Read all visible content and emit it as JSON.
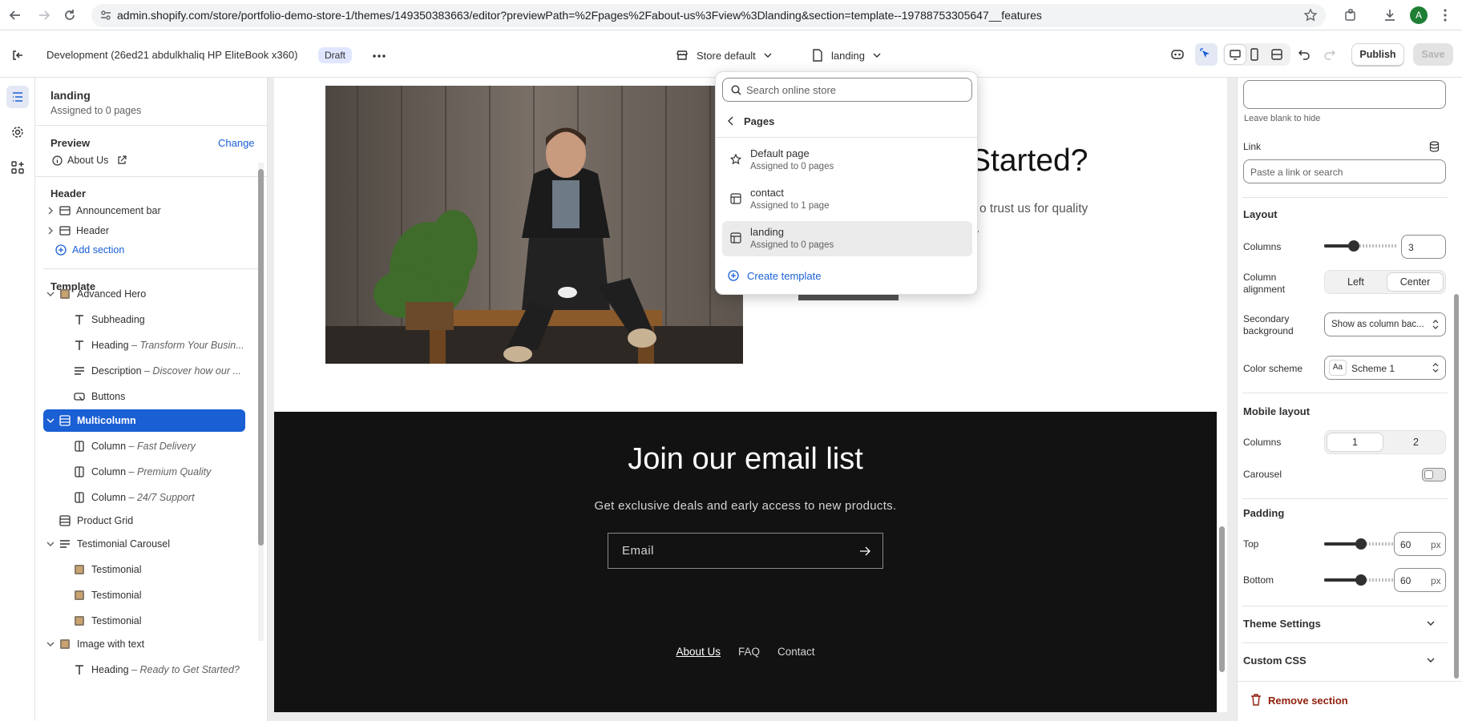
{
  "browser": {
    "url": "admin.shopify.com/store/portfolio-demo-store-1/themes/149350383663/editor?previewPath=%2Fpages%2Fabout-us%3Fview%3Dlanding&section=template--19788753305647__features",
    "avatar_letter": "A"
  },
  "topbar": {
    "theme_name": "Development (26ed21 abdulkhaliq HP EliteBook x360)",
    "badge": "Draft",
    "store_selector": "Store default",
    "template_selector": "landing",
    "publish_label": "Publish",
    "save_label": "Save"
  },
  "sidebar": {
    "template_title": "landing",
    "template_assigned": "Assigned to 0 pages",
    "preview_label": "Preview",
    "change_label": "Change",
    "preview_page": "About Us",
    "header_group_label": "Header",
    "header_items": [
      "Announcement bar",
      "Header"
    ],
    "add_section": "Add section",
    "template_group_label": "Template",
    "tree": [
      {
        "label": "Advanced Hero",
        "sub": ""
      },
      {
        "label": "Subheading",
        "sub": ""
      },
      {
        "label": "Heading",
        "sub": " – Transform Your Busin..."
      },
      {
        "label": "Description",
        "sub": " – Discover how our ..."
      },
      {
        "label": "Buttons",
        "sub": ""
      },
      {
        "label": "Multicolumn",
        "sub": ""
      },
      {
        "label": "Column",
        "sub": " – Fast Delivery"
      },
      {
        "label": "Column",
        "sub": " – Premium Quality"
      },
      {
        "label": "Column",
        "sub": " – 24/7 Support"
      },
      {
        "label": "Product Grid",
        "sub": ""
      },
      {
        "label": "Testimonial Carousel",
        "sub": ""
      },
      {
        "label": "Testimonial",
        "sub": ""
      },
      {
        "label": "Testimonial",
        "sub": ""
      },
      {
        "label": "Testimonial",
        "sub": ""
      },
      {
        "label": "Image with text",
        "sub": ""
      },
      {
        "label": "Heading",
        "sub": " – Ready to Get Started?"
      }
    ]
  },
  "preview": {
    "heading_fragment": "Started?",
    "text_fragment": "o trust us for quality",
    "text_fragment2": ".",
    "newsletter_title": "Join our email list",
    "newsletter_sub": "Get exclusive deals and early access to new products.",
    "email_placeholder": "Email",
    "footer_links": [
      "About Us",
      "FAQ",
      "Contact"
    ]
  },
  "dropdown": {
    "search_placeholder": "Search online store",
    "back_label": "Pages",
    "items": [
      {
        "title": "Default page",
        "sub": "Assigned to 0 pages"
      },
      {
        "title": "contact",
        "sub": "Assigned to 1 page"
      },
      {
        "title": "landing",
        "sub": "Assigned to 0 pages"
      }
    ],
    "create_label": "Create template"
  },
  "settings": {
    "leave_blank_hint": "Leave blank to hide",
    "link_label": "Link",
    "link_placeholder": "Paste a link or search",
    "layout_head": "Layout",
    "columns_label": "Columns",
    "columns_value": "3",
    "columns_level": 0.4,
    "alignment_label": "Column alignment",
    "alignment_options": [
      "Left",
      "Center"
    ],
    "secondary_bg_label": "Secondary background",
    "secondary_bg_value": "Show as column bac...",
    "color_scheme_label": "Color scheme",
    "color_scheme_value": "Scheme 1",
    "mobile_head": "Mobile layout",
    "mobile_columns_label": "Columns",
    "mobile_columns_options": [
      "1",
      "2"
    ],
    "carousel_label": "Carousel",
    "padding_head": "Padding",
    "top_label": "Top",
    "top_value": "60",
    "bottom_label": "Bottom",
    "bottom_value": "60",
    "unit": "px",
    "theme_settings": "Theme Settings",
    "custom_css": "Custom CSS",
    "remove_section": "Remove section"
  },
  "colors": {
    "accent": "#1a5fd4",
    "danger": "#8e1f0b",
    "footer_bg": "#121212"
  }
}
